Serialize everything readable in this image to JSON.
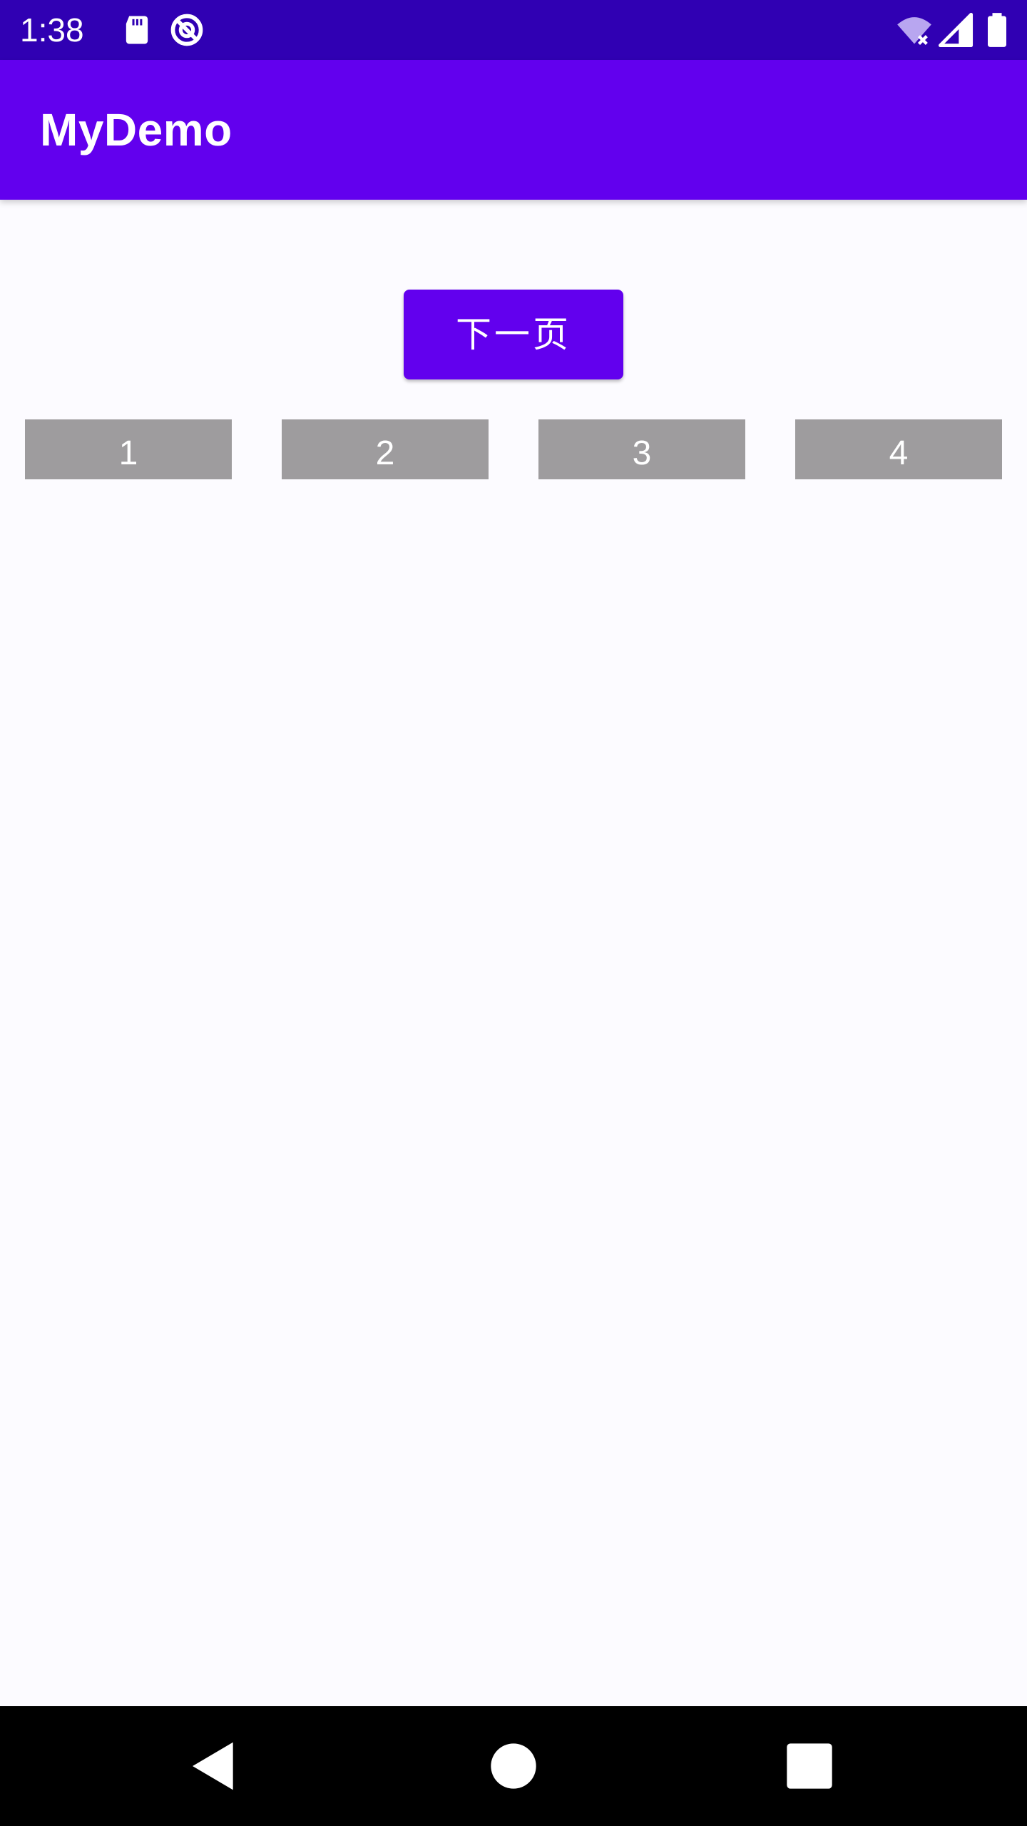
{
  "status_bar": {
    "time": "1:38",
    "left_icons": [
      "sd-card-icon",
      "sync-icon"
    ],
    "right_icons": [
      "wifi-icon",
      "signal-icon",
      "battery-icon"
    ]
  },
  "app_bar": {
    "title": "MyDemo"
  },
  "main": {
    "next_button_label": "下一页",
    "number_boxes": [
      "1",
      "2",
      "3",
      "4"
    ]
  },
  "nav_bar": {
    "icons": [
      "back-icon",
      "home-icon",
      "recents-icon"
    ]
  },
  "colors": {
    "status_bar": "#3000b3",
    "app_bar": "#6200ee",
    "button": "#6200ee",
    "box": "#9e9c9e",
    "background": "#fcfbff",
    "nav_bar": "#000000"
  }
}
